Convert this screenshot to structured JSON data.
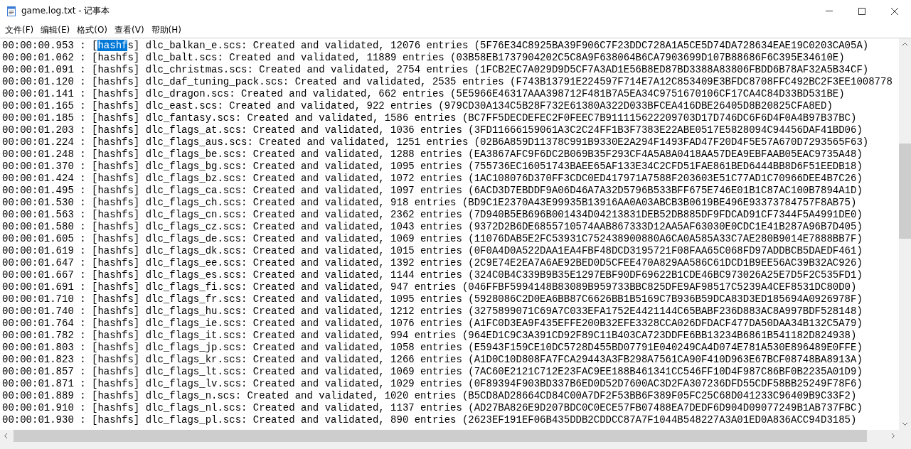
{
  "window": {
    "title": "game.log.txt - 记事本"
  },
  "menu": [
    {
      "label": "文件(F)"
    },
    {
      "label": "编辑(E)"
    },
    {
      "label": "格式(O)"
    },
    {
      "label": "查看(V)"
    },
    {
      "label": "帮助(H)"
    }
  ],
  "lines": [
    {
      "parts": [
        {
          "text": "00:00:00.953 : [",
          "selected": false
        },
        {
          "text": "hashf",
          "selected": true
        },
        {
          "text": "s] dlc_balkan_e.scs: Created and validated, 12076 entries (5F76E34C8925BA39F906C7F23DDC728A1A5CE5D74DA728634EAE19C0203CA05A)",
          "selected": false
        }
      ]
    },
    {
      "parts": [
        {
          "text": "00:00:01.062 : [hashfs] dlc_balt.scs: Created and validated, 11889 entries (03B58EB1737904202C5C8A9F638064B6CA7903699D107B88686F6C395E34610E)",
          "selected": false
        }
      ]
    },
    {
      "parts": [
        {
          "text": "00:00:01.091 : [hashfs] dlc_christmas.scs: Created and validated, 2754 entries (1FCB2EC7A029D9D5CF7A3AD1E56B8ED87BD3388A83806FBDD6B78AF32A5B34CF)",
          "selected": false
        }
      ]
    },
    {
      "parts": [
        {
          "text": "00:00:01.120 : [hashfs] dlc_daf_tuning_pack.scs: Created and validated, 2535 entries (F743B13791E224597F714E7A12C853409E3BFDC8708FFC492BC2F3EE1008778",
          "selected": false
        }
      ]
    },
    {
      "parts": [
        {
          "text": "00:00:01.141 : [hashfs] dlc_dragon.scs: Created and validated, 662 entries (5E5966E46317AAA398712F481B7A5EA34C9751670106CF17CA4C84D33BD531BE)",
          "selected": false
        }
      ]
    },
    {
      "parts": [
        {
          "text": "00:00:01.165 : [hashfs] dlc_east.scs: Created and validated, 922 entries (979CD30A134C5B28F732E61380A322D033BFCEA416DBE26405D8B20825CFA8ED)",
          "selected": false
        }
      ]
    },
    {
      "parts": [
        {
          "text": "00:00:01.185 : [hashfs] dlc_fantasy.scs: Created and validated, 1586 entries (BC7FF5DECDEFEC2F0FEEC7B911115622209703D17D746DC6F6D4F0A4B97B37BC)",
          "selected": false
        }
      ]
    },
    {
      "parts": [
        {
          "text": "00:00:01.203 : [hashfs] dlc_flags_at.scs: Created and validated, 1036 entries (3FD11666159061A3C2C24FF1B3F7383E22ABE0517E5828094C94456DAF41BD06)",
          "selected": false
        }
      ]
    },
    {
      "parts": [
        {
          "text": "00:00:01.224 : [hashfs] dlc_flags_aus.scs: Created and validated, 1251 entries (02B6A859D11378C991B9330E2A294F1493FAD47F20D4F5E57A670D7293565F63)",
          "selected": false
        }
      ]
    },
    {
      "parts": [
        {
          "text": "00:00:01.248 : [hashfs] dlc_flags_be.scs: Created and validated, 1288 entries (EA3867AFC9F6DC2B069B35F293CF4A5A8A0418AA57DEA9EBFAAB05EAC9735A48)",
          "selected": false
        }
      ]
    },
    {
      "parts": [
        {
          "text": "00:00:01.370 : [hashfs] dlc_flags_bg.scs: Created and validated, 1095 entries (755736EC16051743BAEE65AF133E34C2CFD51FAE861BED6444BB8D6F51EEDB18)",
          "selected": false
        }
      ]
    },
    {
      "parts": [
        {
          "text": "00:00:01.424 : [hashfs] dlc_flags_bz.scs: Created and validated, 1072 entries (1AC108076D370FF3CDC0ED417971A7588F203603E51C77AD1C70966DEE4B7C26)",
          "selected": false
        }
      ]
    },
    {
      "parts": [
        {
          "text": "00:00:01.495 : [hashfs] dlc_flags_ca.scs: Created and validated, 1097 entries (6ACD3D7EBDDF9A06D46A7A32D5796B533BFF675E746E01B1C87AC100B7894A1D)",
          "selected": false
        }
      ]
    },
    {
      "parts": [
        {
          "text": "00:00:01.530 : [hashfs] dlc_flags_ch.scs: Created and validated, 918 entries (BD9C1E2370A43E99935B13916AA0A03ABCB3B0619BE496E93373784757F8AB75)",
          "selected": false
        }
      ]
    },
    {
      "parts": [
        {
          "text": "00:00:01.563 : [hashfs] dlc_flags_cn.scs: Created and validated, 2362 entries (7D940B5EB696B001434D04213831DEB52DB885DF9FDCAD91CF7344F5A4991DE0)",
          "selected": false
        }
      ]
    },
    {
      "parts": [
        {
          "text": "00:00:01.580 : [hashfs] dlc_flags_cz.scs: Created and validated, 1043 entries (9372D2B6DE6855710574AAB867333D12AA5AF63030E0CDC1E41B287A96B7D405)",
          "selected": false
        }
      ]
    },
    {
      "parts": [
        {
          "text": "00:00:01.605 : [hashfs] dlc_flags_de.scs: Created and validated, 1069 entries (11076DAB5E2FC53931C752438900880A6CA0A585A33C7AE280B9014E7888BB7F)",
          "selected": false
        }
      ]
    },
    {
      "parts": [
        {
          "text": "00:00:01.619 : [hashfs] dlc_flags_dk.scs: Created and validated, 1015 entries (0F0A4D0A522DAA1EA4FBF48DCD3195721F08FAA65C068FD97ADDBCB5DAEDF461)",
          "selected": false
        }
      ]
    },
    {
      "parts": [
        {
          "text": "00:00:01.647 : [hashfs] dlc_flags_ee.scs: Created and validated, 1392 entries (2C9E74E2EA7A6AE92BED0D5CFEE470A829AA586C61DCD1B9EE56AC39B32AC926)",
          "selected": false
        }
      ]
    },
    {
      "parts": [
        {
          "text": "00:00:01.667 : [hashfs] dlc_flags_es.scs: Created and validated, 1144 entries (324C0B4C339B9B35E1297EBF90DF69622B1CDE46BC973026A25E7D5F2C535FD1)",
          "selected": false
        }
      ]
    },
    {
      "parts": [
        {
          "text": "00:00:01.691 : [hashfs] dlc_flags_fi.scs: Created and validated, 947 entries (046FFBF5994148B83089B959733BBC825DFE9AF98517C5239A4CEF8531DC80D0)",
          "selected": false
        }
      ]
    },
    {
      "parts": [
        {
          "text": "00:00:01.710 : [hashfs] dlc_flags_fr.scs: Created and validated, 1095 entries (5928086C2D0EA6BB87C6626BB1B5169C7B936B59DCA83D3ED185694A0926978F)",
          "selected": false
        }
      ]
    },
    {
      "parts": [
        {
          "text": "00:00:01.740 : [hashfs] dlc_flags_hu.scs: Created and validated, 1212 entries (3275899071C69A7C033EFA1752E4421144C65BABF236D883AC8A997BDF528148)",
          "selected": false
        }
      ]
    },
    {
      "parts": [
        {
          "text": "00:00:01.764 : [hashfs] dlc_flags_ie.scs: Created and validated, 1076 entries (A1FC0D3EA9F435EFFE200B32EFE3328CCA026DFDACF477DA50DAA34B132C5A79)",
          "selected": false
        }
      ]
    },
    {
      "parts": [
        {
          "text": "00:00:01.782 : [hashfs] dlc_flags_it.scs: Created and validated, 994 entries (964ED1C9C3A391CD92F89C11B403CA723DDFE6BB13234B6861B541182D824938)",
          "selected": false
        }
      ]
    },
    {
      "parts": [
        {
          "text": "00:00:01.803 : [hashfs] dlc_flags_jp.scs: Created and validated, 1058 entries (E5943F159CE10DC5728D455BD07791E040249CA4D074E781A530E896489E0FFE)",
          "selected": false
        }
      ]
    },
    {
      "parts": [
        {
          "text": "00:00:01.823 : [hashfs] dlc_flags_kr.scs: Created and validated, 1266 entries (A1D0C10D808FA7FCA29443A3FB298A7561CA90F410D963E67BCF08748BA8913A)",
          "selected": false
        }
      ]
    },
    {
      "parts": [
        {
          "text": "00:00:01.857 : [hashfs] dlc_flags_lt.scs: Created and validated, 1069 entries (7AC60E2121C712E23FAC9EE188B461341CC546FF10D4F987C86BF0B2235A01D9)",
          "selected": false
        }
      ]
    },
    {
      "parts": [
        {
          "text": "00:00:01.871 : [hashfs] dlc_flags_lv.scs: Created and validated, 1029 entries (0F89394F903BD337B6ED0D52D7600AC3D2FA307236DFD55CDF58BB25249F78F6)",
          "selected": false
        }
      ]
    },
    {
      "parts": [
        {
          "text": "00:00:01.889 : [hashfs] dlc_flags_n.scs: Created and validated, 1020 entries (B5CD8AD28664CD84C00A7DF2F53BB6F389F05FC25C68D041233C96409B9C33F2)",
          "selected": false
        }
      ]
    },
    {
      "parts": [
        {
          "text": "00:00:01.910 : [hashfs] dlc_flags_nl.scs: Created and validated, 1137 entries (AD27BA826E9D207BDC0C0ECE57FB07488EA7DEDF6D904D09077249B1AB737FBC)",
          "selected": false
        }
      ]
    },
    {
      "parts": [
        {
          "text": "00:00:01.930 : [hashfs] dlc_flags_pl.scs: Created and validated, 890 entries (2623EF191EF06B435DDB2CDDCC87A7F1044B548227A3A01ED0A836ACC94D3185)",
          "selected": false
        }
      ]
    }
  ]
}
